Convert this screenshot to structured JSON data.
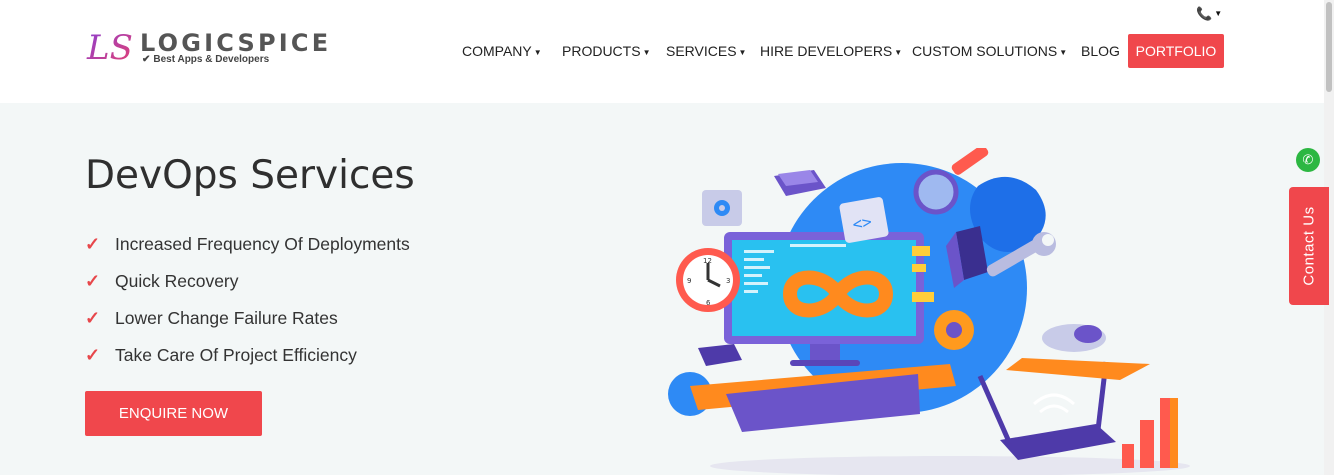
{
  "brand": {
    "logo_letters": "LS",
    "name": "LOGICSPICE",
    "tagline": "Best Apps & Developers"
  },
  "header": {
    "phone_icon": "phone-icon",
    "nav": [
      {
        "label": "COMPANY",
        "dropdown": true
      },
      {
        "label": "PRODUCTS",
        "dropdown": true
      },
      {
        "label": "SERVICES",
        "dropdown": true
      },
      {
        "label": "HIRE DEVELOPERS",
        "dropdown": true
      },
      {
        "label": "CUSTOM SOLUTIONS",
        "dropdown": true
      },
      {
        "label": "BLOG",
        "dropdown": false
      }
    ],
    "portfolio_label": "PORTFOLIO"
  },
  "hero": {
    "title": "DevOps Services",
    "benefits": [
      "Increased Frequency Of Deployments",
      "Quick Recovery",
      "Lower Change Failure Rates",
      "Take Care Of Project Efficiency"
    ],
    "cta_label": "ENQUIRE NOW"
  },
  "side": {
    "contact_label": "Contact Us",
    "whatsapp_icon": "whatsapp-icon"
  },
  "colors": {
    "accent": "#f0474c",
    "hero_bg": "#f3f7f7",
    "illustration_blue": "#2e8af5"
  }
}
